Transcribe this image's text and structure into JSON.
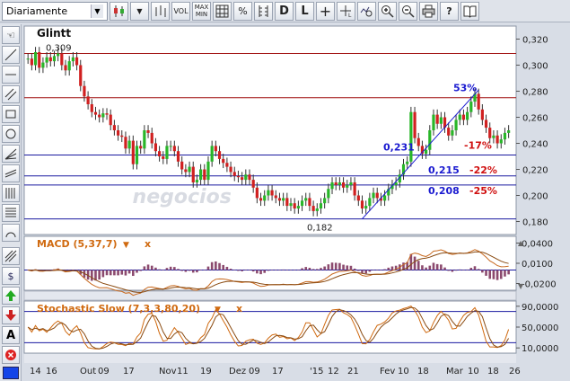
{
  "toolbar": {
    "period_select": "Diariamente",
    "vol_label": "VOL",
    "maxmin_label_top": "MAX",
    "maxmin_label_bottom": "MIN",
    "percent_label": "%",
    "d_label": "D",
    "l_label": "L",
    "help_label": "?"
  },
  "chart_data": [
    {
      "type": "candlestick",
      "title": "Glintt",
      "watermark": "negocios",
      "y_ticks": [
        "0,320",
        "0,300",
        "0,280",
        "0,260",
        "0,240",
        "0,220",
        "0,200",
        "0,180"
      ],
      "ylim": [
        0.17,
        0.33
      ],
      "x_ticks": [
        "14",
        "16",
        "Out",
        "09",
        "17",
        "Nov",
        "11",
        "19",
        "Dez",
        "09",
        "17",
        "'15",
        "12",
        "21",
        "Fev",
        "10",
        "18",
        "Mar",
        "10",
        "18",
        "26"
      ],
      "annotations": [
        "0,309",
        "0,182",
        "53%",
        "0,231",
        "-17%",
        "0,215",
        "-22%",
        "0,208",
        "-25%"
      ],
      "horizontal_levels": [
        0.309,
        0.275,
        0.231,
        0.215,
        0.208,
        0.182
      ],
      "close": [
        0.305,
        0.3,
        0.31,
        0.298,
        0.302,
        0.306,
        0.303,
        0.307,
        0.309,
        0.3,
        0.296,
        0.303,
        0.306,
        0.3,
        0.284,
        0.276,
        0.27,
        0.264,
        0.262,
        0.26,
        0.263,
        0.262,
        0.254,
        0.25,
        0.246,
        0.245,
        0.236,
        0.242,
        0.224,
        0.238,
        0.236,
        0.25,
        0.248,
        0.24,
        0.234,
        0.23,
        0.228,
        0.238,
        0.238,
        0.234,
        0.226,
        0.22,
        0.218,
        0.222,
        0.21,
        0.212,
        0.22,
        0.212,
        0.226,
        0.238,
        0.234,
        0.228,
        0.225,
        0.222,
        0.218,
        0.215,
        0.214,
        0.212,
        0.216,
        0.212,
        0.206,
        0.198,
        0.196,
        0.2,
        0.204,
        0.2,
        0.198,
        0.196,
        0.198,
        0.192,
        0.194,
        0.19,
        0.192,
        0.196,
        0.198,
        0.192,
        0.188,
        0.19,
        0.194,
        0.198,
        0.205,
        0.21,
        0.208,
        0.21,
        0.206,
        0.208,
        0.21,
        0.2,
        0.196,
        0.19,
        0.192,
        0.198,
        0.202,
        0.198,
        0.196,
        0.2,
        0.205,
        0.208,
        0.21,
        0.216,
        0.224,
        0.226,
        0.264,
        0.244,
        0.238,
        0.232,
        0.235,
        0.25,
        0.262,
        0.255,
        0.26,
        0.252,
        0.246,
        0.25,
        0.258,
        0.262,
        0.258,
        0.264,
        0.272,
        0.278,
        0.266,
        0.258,
        0.252,
        0.244,
        0.246,
        0.24,
        0.243,
        0.248,
        0.25
      ]
    },
    {
      "type": "line",
      "title": "MACD (5,37,7)",
      "y_ticks": [
        "0,0400",
        "0,0100",
        "-0,0200"
      ],
      "ylim": [
        -0.03,
        0.05
      ]
    },
    {
      "type": "line",
      "title": "Stochastic Slow (7,3,3,80,20)",
      "y_ticks": [
        "90,0000",
        "50,0000",
        "10,0000"
      ],
      "ylim": [
        0,
        100
      ]
    }
  ]
}
